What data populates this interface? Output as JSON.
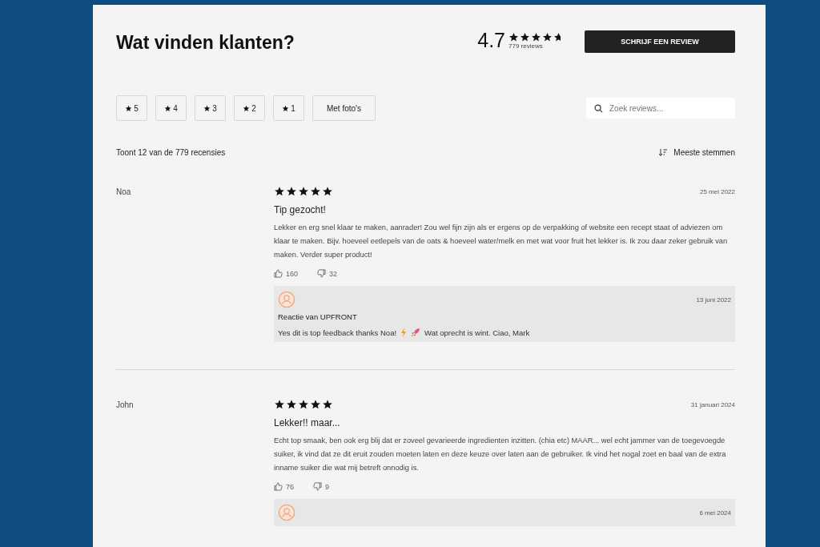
{
  "header": {
    "title": "Wat vinden klanten?",
    "rating": "4.7",
    "stars": 4.7,
    "review_count": "779 reviews",
    "write_button": "SCHRIJF EEN REVIEW"
  },
  "filters": [
    {
      "label": "5",
      "kind": "star",
      "selected": false
    },
    {
      "label": "4",
      "kind": "star",
      "selected": false
    },
    {
      "label": "3",
      "kind": "star",
      "selected": false
    },
    {
      "label": "2",
      "kind": "star",
      "selected": false
    },
    {
      "label": "1",
      "kind": "star",
      "selected": false
    },
    {
      "label": "Met foto's",
      "kind": "text",
      "selected": false
    }
  ],
  "search": {
    "placeholder": "Zoek reviews..."
  },
  "summary": "Toont 12 van de 779 recensies",
  "sort": "Meeste stemmen",
  "reviews": [
    {
      "author": "Noa",
      "stars": 5,
      "date": "25 mei 2022",
      "title": "Tip gezocht!",
      "body": "Lekker en erg snel klaar te maken, aanrader! Zou wel fijn zijn als er ergens op de verpakking of website een recept staat of adviezen om klaar te maken. Bijv. hoeveel eetlepels van de oats & hoeveel water/melk en met wat voor fruit het lekker is. Ik zou daar zeker gebruik van maken. Verder super product!",
      "likes": "160",
      "dislikes": "32",
      "reply": {
        "date": "13 juni 2022",
        "title": "Reactie van UPFRONT",
        "text_before": "Yes dit is top feedback thanks Noa!",
        "text_after": "Wat oprecht is wint. Ciao, Mark"
      }
    },
    {
      "author": "John",
      "stars": 5,
      "date": "31 januari 2024",
      "title": "Lekker!! maar...",
      "body": "Echt top smaak, ben ook erg blij dat er zoveel gevarieerde ingredienten inzitten. (chia etc) MAAR... wel echt jammer van de toegevoegde suiker, ik vind dat ze dit eruit zouden moeten laten en deze keuze over laten aan de gebruiker. Ik vind het nogal zoet en baal van de extra inname suiker die wat mij betreft onnodig is.",
      "likes": "76",
      "dislikes": "9",
      "reply": {
        "date": "6 mei 2024"
      }
    }
  ]
}
